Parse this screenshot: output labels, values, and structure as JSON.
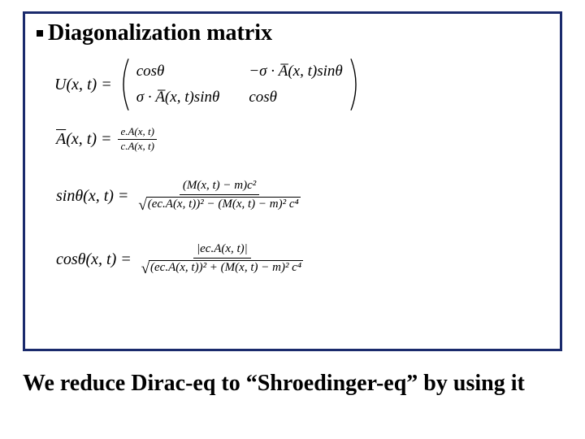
{
  "heading": "Diagonalization matrix",
  "matrix": {
    "lhs": "U(x, t) =",
    "c11": "cosθ",
    "c12": "−σ · A̅(x, t)sinθ",
    "c21": "σ · A̅(x, t)sinθ",
    "c22": "cosθ"
  },
  "abar": {
    "lhs": "A̅(x, t) =",
    "num": "e.A(x, t)",
    "den": "c.A(x, t)"
  },
  "sintheta": {
    "lhs": "sinθ(x, t) =",
    "num": "(M(x, t) − m)c²",
    "radicand": "(ec.A(x, t))² − (M(x, t) − m)² c⁴"
  },
  "costheta": {
    "lhs": "cosθ(x, t) =",
    "num": "|ec.A(x, t)|",
    "radicand": "(ec.A(x, t))² + (M(x, t) − m)² c⁴"
  },
  "footer": "We reduce Dirac-eq to “Shroedinger-eq” by using it"
}
